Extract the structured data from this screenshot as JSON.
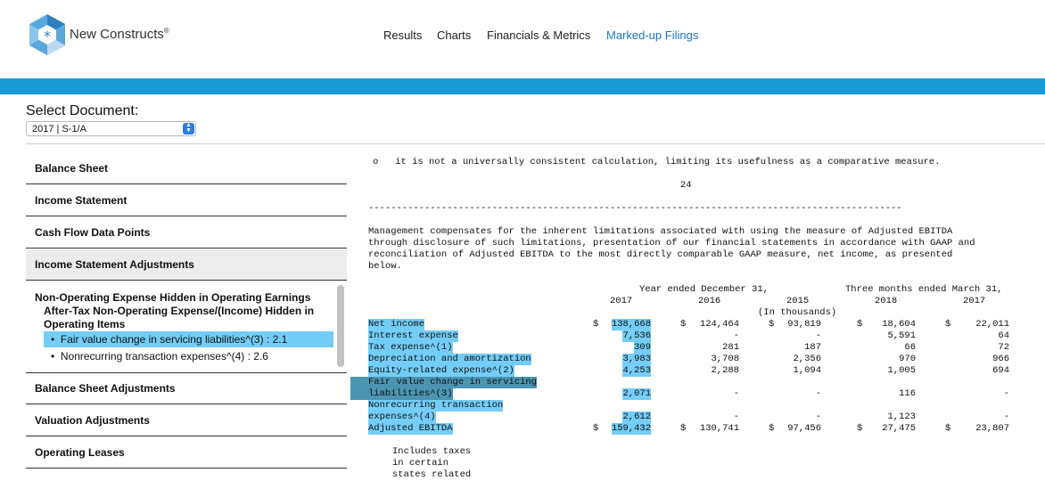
{
  "brand": {
    "name": "New Constructs",
    "reg": "®"
  },
  "nav": {
    "items": [
      "Results",
      "Charts",
      "Financials & Metrics",
      "Marked-up Filings"
    ],
    "active": "Marked-up Filings"
  },
  "colors": {
    "accent_bar": "#1a9ad6",
    "highlight": "#73cdf7",
    "highlight_dark": "#4b95b2",
    "active_link": "#1a74c4"
  },
  "select_document": {
    "label": "Select Document:",
    "value": "2017 | S-1/A"
  },
  "sidebar": {
    "items": [
      "Balance Sheet",
      "Income Statement",
      "Cash Flow Data Points",
      "Income Statement Adjustments",
      "Balance Sheet Adjustments",
      "Valuation Adjustments",
      "Operating Leases"
    ],
    "sub": {
      "title": "Non-Operating Expense Hidden in Operating Earnings",
      "subtitle": "After-Tax Non-Operating Expense/(Income) Hidden in Operating Items",
      "entries": [
        "Fair value change in servicing liabilities^(3) : 2.1",
        "Nonrecurring transaction expenses^(4) : 2.6"
      ]
    }
  },
  "document": {
    "bullet_line": "o   it is not a universally consistent calculation, limiting its usefulness as a comparative measure.",
    "page_number": "24",
    "divider": "-----------------------------------------------------------------------------------------------",
    "paragraph": [
      "Management compensates for the inherent limitations associated with using the measure of Adjusted EBITDA",
      "through disclosure of such limitations, presentation of our financial statements in accordance with GAAP and",
      "reconciliation of Adjusted EBITDA to the most directly comparable GAAP measure, net income, as presented",
      "below."
    ],
    "header_year_ended": "Year ended December 31,",
    "header_three_months": "Three months ended March 31,",
    "years": [
      "2017",
      "2016",
      "2015",
      "2018",
      "2017"
    ],
    "in_thousands": "(In thousands)",
    "rows": [
      {
        "label": "Net income",
        "v": [
          "138,668",
          "124,464",
          "93,819",
          "18,604",
          "22,011"
        ]
      },
      {
        "label": "Interest expense",
        "v": [
          "7,536",
          "-",
          "-",
          "5,591",
          "64"
        ]
      },
      {
        "label": "Tax expense^(1)",
        "v": [
          "309",
          "281",
          "187",
          "66",
          "72"
        ]
      },
      {
        "label": "Depreciation and amortization",
        "v": [
          "3,983",
          "3,708",
          "2,356",
          "970",
          "966"
        ]
      },
      {
        "label": "Equity-related expense^(2)",
        "v": [
          "4,253",
          "2,288",
          "1,094",
          "1,005",
          "694"
        ]
      },
      {
        "label": "Fair value change in servicing",
        "v": [
          "",
          "",
          "",
          "",
          ""
        ]
      },
      {
        "label": "liabilities^(3)",
        "v": [
          "2,071",
          "-",
          "-",
          "116",
          "-"
        ]
      },
      {
        "label": "Nonrecurring transaction",
        "v": [
          "",
          "",
          "",
          "",
          ""
        ]
      },
      {
        "label": "expenses^(4)",
        "v": [
          "2,612",
          "-",
          "-",
          "1,123",
          "-"
        ]
      },
      {
        "label": "Adjusted EBITDA",
        "v": [
          "159,432",
          "130,741",
          "97,456",
          "27,475",
          "23,807"
        ]
      }
    ],
    "dollar": "$",
    "footnote": [
      "Includes taxes",
      "in certain",
      "states related"
    ]
  }
}
